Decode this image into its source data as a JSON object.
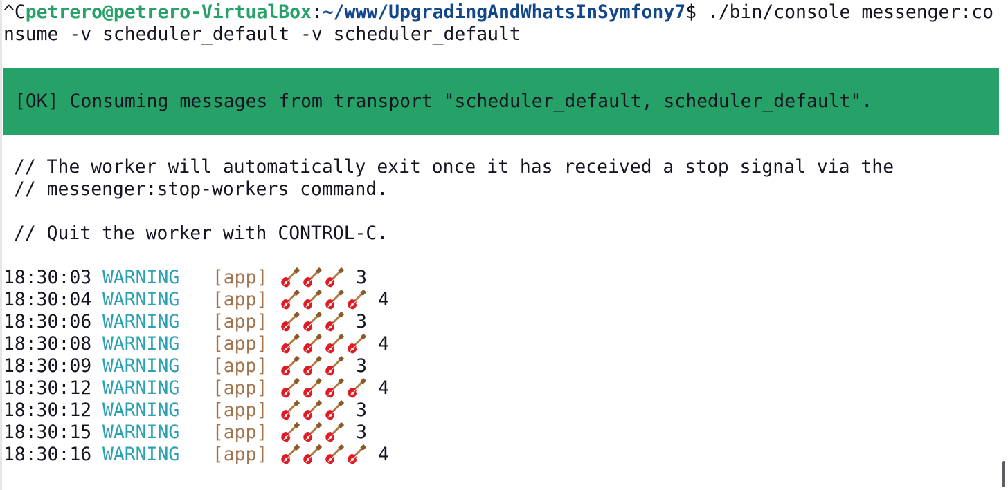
{
  "prompt": {
    "prefix": "^C",
    "user_host": "petrero@petrero-VirtualBox",
    "separator": ":",
    "path": "~/www/UpgradingAndWhatsInSymfony7",
    "symbol": "$",
    "command_line1": " ./bin/console messenger:co",
    "command_line2": "nsume -v scheduler_default -v scheduler_default"
  },
  "ok_message": "[OK] Consuming messages from transport \"scheduler_default, scheduler_default\".",
  "notes": [
    "// The worker will automatically exit once it has received a stop signal via the",
    "// messenger:stop-workers command.",
    "// Quit the worker with CONTROL-C."
  ],
  "log_entries": [
    {
      "time": "18:30:03",
      "level": "WARNING",
      "channel": "[app]",
      "guitars": 3,
      "count": "3"
    },
    {
      "time": "18:30:04",
      "level": "WARNING",
      "channel": "[app]",
      "guitars": 4,
      "count": "4"
    },
    {
      "time": "18:30:06",
      "level": "WARNING",
      "channel": "[app]",
      "guitars": 3,
      "count": "3"
    },
    {
      "time": "18:30:08",
      "level": "WARNING",
      "channel": "[app]",
      "guitars": 4,
      "count": "4"
    },
    {
      "time": "18:30:09",
      "level": "WARNING",
      "channel": "[app]",
      "guitars": 3,
      "count": "3"
    },
    {
      "time": "18:30:12",
      "level": "WARNING",
      "channel": "[app]",
      "guitars": 4,
      "count": "4"
    },
    {
      "time": "18:30:12",
      "level": "WARNING",
      "channel": "[app]",
      "guitars": 3,
      "count": "3"
    },
    {
      "time": "18:30:15",
      "level": "WARNING",
      "channel": "[app]",
      "guitars": 3,
      "count": "3"
    },
    {
      "time": "18:30:16",
      "level": "WARNING",
      "channel": "[app]",
      "guitars": 4,
      "count": "4"
    }
  ],
  "icons": {
    "log_emoji": "guitar-icon"
  },
  "colors": {
    "background": "#ffffff",
    "text": "#171421",
    "prompt_user": "#26a269",
    "prompt_path": "#12488b",
    "ok_background": "#26a269",
    "level": "#2aa1b3",
    "channel": "#a2734c"
  }
}
